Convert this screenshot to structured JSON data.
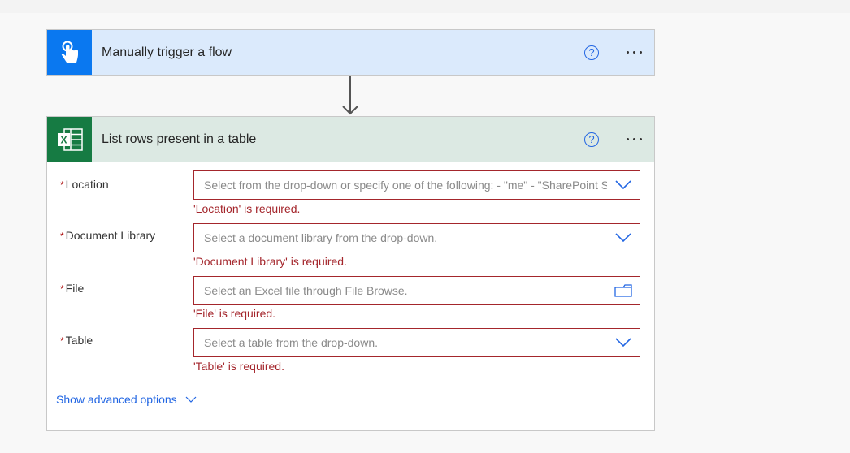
{
  "trigger_card": {
    "title": "Manually trigger a flow",
    "icon": "touch-hand-icon",
    "help_icon_glyph": "?",
    "color": "#0a78f0"
  },
  "action_card": {
    "title": "List rows present in a table",
    "icon": "excel-icon",
    "help_icon_glyph": "?",
    "color": "#167b43",
    "fields": [
      {
        "label": "Location",
        "required_mark": "*",
        "placeholder": "Select from the drop-down or specify one of the following: - \"me\" - \"SharePoint Site URL\" - \"users/someone's UPN\" - \"groups/group Id\" - \"sites/SharePoint Site URL:/teams/team name:\" (the colons are required).",
        "control": "dropdown",
        "error": "'Location' is required."
      },
      {
        "label": "Document Library",
        "required_mark": "*",
        "placeholder": "Select a document library from the drop-down.",
        "control": "dropdown",
        "error": "'Document Library' is required."
      },
      {
        "label": "File",
        "required_mark": "*",
        "placeholder": "Select an Excel file through File Browse.",
        "control": "file-browse",
        "error": "'File' is required."
      },
      {
        "label": "Table",
        "required_mark": "*",
        "placeholder": "Select a table from the drop-down.",
        "control": "dropdown",
        "error": "'Table' is required."
      }
    ],
    "advanced_options_label": "Show advanced options"
  },
  "colors": {
    "error": "#a4262c",
    "link": "#2266e3"
  }
}
